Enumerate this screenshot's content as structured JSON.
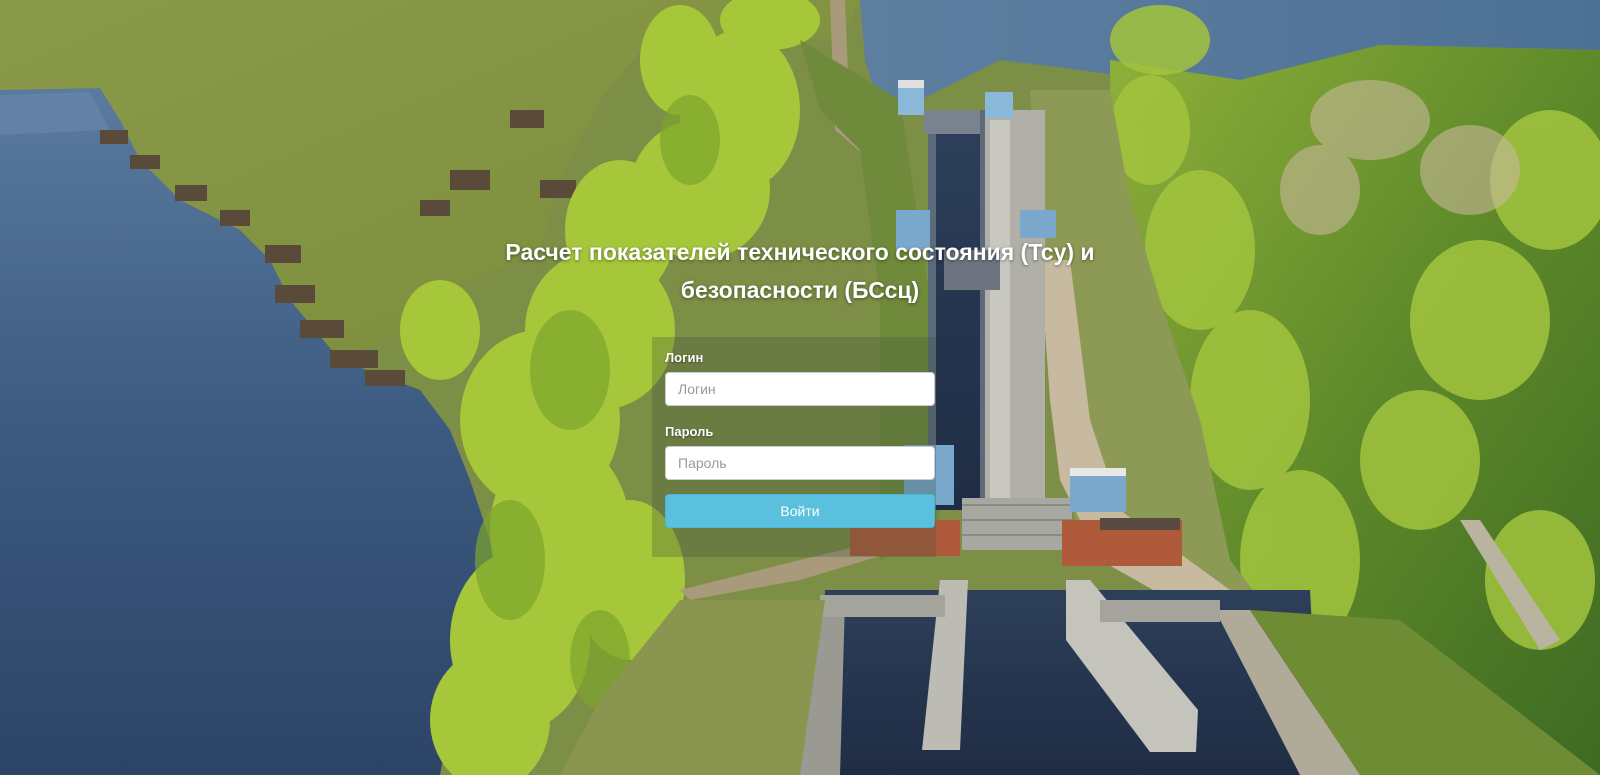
{
  "page": {
    "title_line1": "Расчет показателей технического состояния (Тсу) и",
    "title_line2": "безопасности (БСсц)"
  },
  "login_form": {
    "login_label": "Логин",
    "login_placeholder": "Логин",
    "login_value": "",
    "password_label": "Пароль",
    "password_placeholder": "Пароль",
    "password_value": "",
    "submit_label": "Войти"
  },
  "colors": {
    "button_bg": "#5bc0de",
    "button_border": "#46b8da",
    "title_text": "#ffffff"
  },
  "background": {
    "subject": "aerial photo of river ship lock with forest and village"
  }
}
